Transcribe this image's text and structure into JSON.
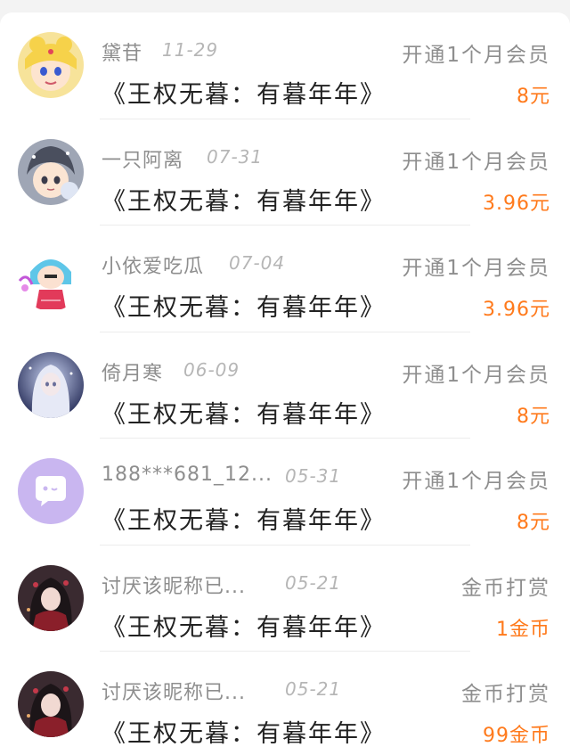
{
  "records": [
    {
      "user": "黛苷",
      "date": "11-29",
      "type": "开通1个月会员",
      "book": "《王权无暮：有暮年年》",
      "amount": "8元",
      "avatar": "sailor-moon-avatar"
    },
    {
      "user": "一只阿离",
      "date": "07-31",
      "type": "开通1个月会员",
      "book": "《王权无暮：有暮年年》",
      "amount": "3.96元",
      "avatar": "anime-boy-avatar"
    },
    {
      "user": "小依爱吃瓜",
      "date": "07-04",
      "type": "开通1个月会员",
      "book": "《王权无暮：有暮年年》",
      "amount": "3.96元",
      "avatar": "cartoon-girl-avatar"
    },
    {
      "user": "倚月寒",
      "date": "06-09",
      "type": "开通1个月会员",
      "book": "《王权无暮：有暮年年》",
      "amount": "8元",
      "avatar": "silver-hair-avatar"
    },
    {
      "user": "188***681_12...",
      "date": "05-31",
      "type": "开通1个月会员",
      "book": "《王权无暮：有暮年年》",
      "amount": "8元",
      "avatar": "default-chat-avatar"
    },
    {
      "user": "讨厌该昵称已...",
      "date": "05-21",
      "type": "金币打赏",
      "book": "《王权无暮：有暮年年》",
      "amount": "1金币",
      "avatar": "dark-anime-avatar"
    },
    {
      "user": "讨厌该昵称已...",
      "date": "05-21",
      "type": "金币打赏",
      "book": "《王权无暮：有暮年年》",
      "amount": "99金币",
      "avatar": "dark-anime-avatar"
    }
  ],
  "colors": {
    "amount": "#ff7a1c",
    "muted": "#8e8e8e",
    "title": "#222222",
    "default_avatar": "#c9b6f0"
  }
}
